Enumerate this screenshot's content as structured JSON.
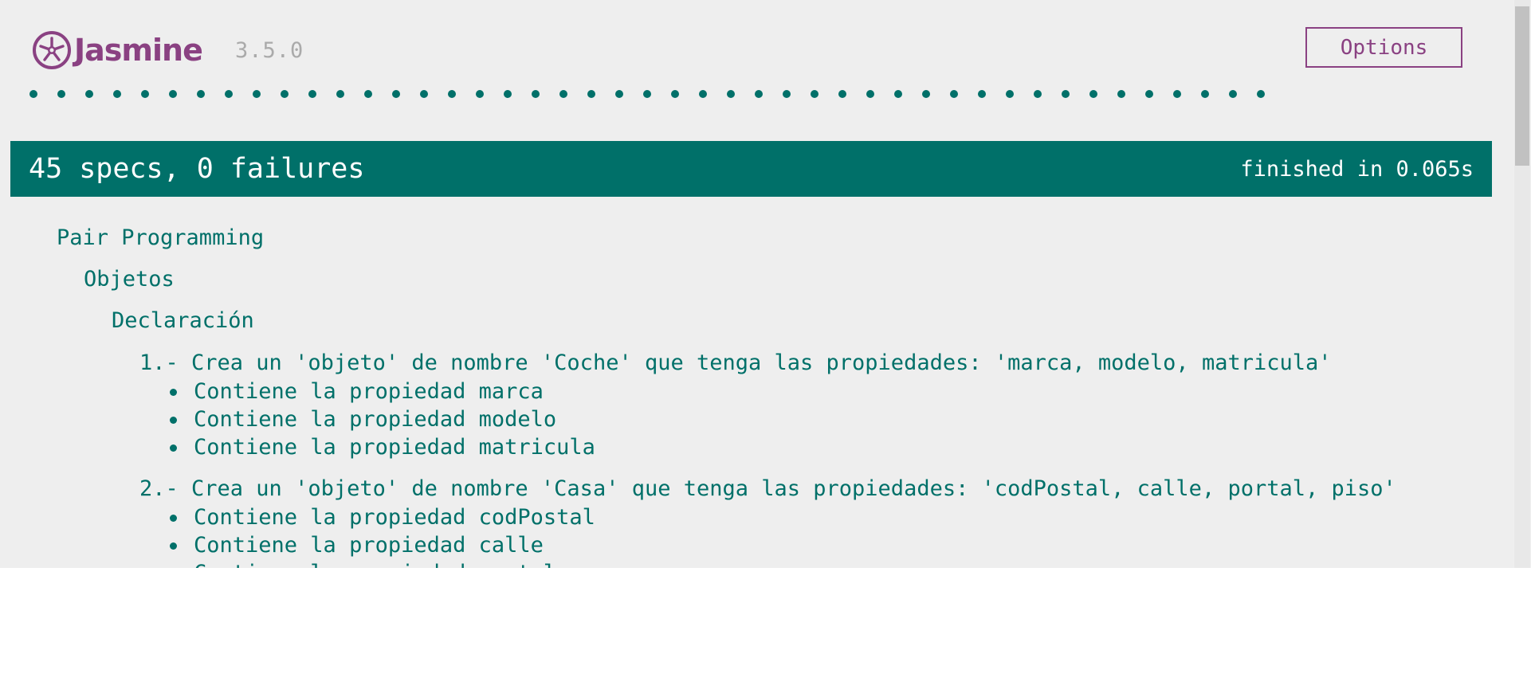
{
  "banner": {
    "logo_text": "Jasmine",
    "version": "3.5.0",
    "options_label": "Options"
  },
  "symbol_summary": {
    "passed_count": 45,
    "color": "#007069"
  },
  "alert": {
    "overall": "45 specs, 0 failures",
    "duration": "finished in 0.065s",
    "color": "#007069"
  },
  "results": {
    "suite_root": "Pair Programming",
    "suite_objetos": "Objetos",
    "suite_declaracion": "Declaración",
    "suites": [
      {
        "title": "1.- Crea un 'objeto' de nombre 'Coche' que tenga las propiedades: 'marca, modelo, matricula'",
        "specs": [
          "Contiene la propiedad marca",
          "Contiene la propiedad modelo",
          "Contiene la propiedad matricula"
        ]
      },
      {
        "title": "2.- Crea un 'objeto' de nombre 'Casa' que tenga las propiedades: 'codPostal, calle, portal, piso'",
        "specs": [
          "Contiene la propiedad codPostal",
          "Contiene la propiedad calle",
          "Contiene la propiedad portal"
        ]
      }
    ]
  },
  "colors": {
    "brand": "#8a4182",
    "passed": "#007069",
    "background": "#eeeeee"
  }
}
